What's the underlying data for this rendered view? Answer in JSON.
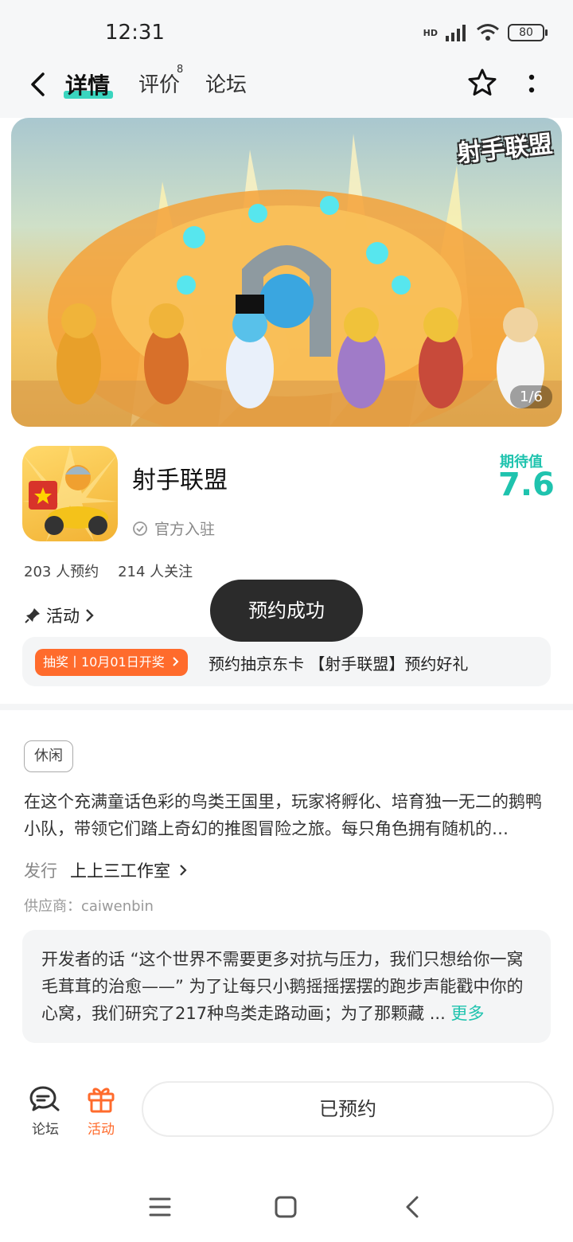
{
  "status_bar": {
    "time": "12:31",
    "battery": "80",
    "network": "HD"
  },
  "header": {
    "tabs": [
      {
        "label": "详情"
      },
      {
        "label": "评价",
        "badge": "8"
      },
      {
        "label": "论坛"
      }
    ]
  },
  "banner": {
    "logo_text": "射手联盟",
    "counter": "1/6"
  },
  "app": {
    "name": "射手联盟",
    "official_label": "官方入驻",
    "expect_label": "期待值",
    "expect_value": "7.6",
    "reservations": "203 人预约",
    "followers": "214 人关注"
  },
  "activity": {
    "title": "活动",
    "tag": "抽奖丨10月01日开奖",
    "text": "预约抽京东卡 【射手联盟】预约好礼"
  },
  "toast": "预约成功",
  "details": {
    "genre": "休闲",
    "description": "在这个充满童话色彩的鸟类王国里，玩家将孵化、培育独一无二的鹅鸭小队，带领它们踏上奇幻的推图冒险之旅。每只角色拥有随机的…",
    "publisher_label": "发行",
    "publisher_name": "上上三工作室",
    "supplier": "供应商：caiwenbin",
    "dev_note": "开发者的话 “这个世界不需要更多对抗与压力，我们只想给你一窝毛茸茸的治愈——” 为了让每只小鹅摇摇摆摆的跑步声能戳中你的心窝，我们研究了217种鸟类走路动画；为了那颗藏 ...",
    "more": "更多"
  },
  "bottom_bar": {
    "forum_label": "论坛",
    "activity_label": "活动",
    "reserve_label": "已预约"
  },
  "colors": {
    "accent": "#1fc3ae",
    "orange": "#ff6b2c",
    "toast_bg": "#2b2b2b"
  }
}
